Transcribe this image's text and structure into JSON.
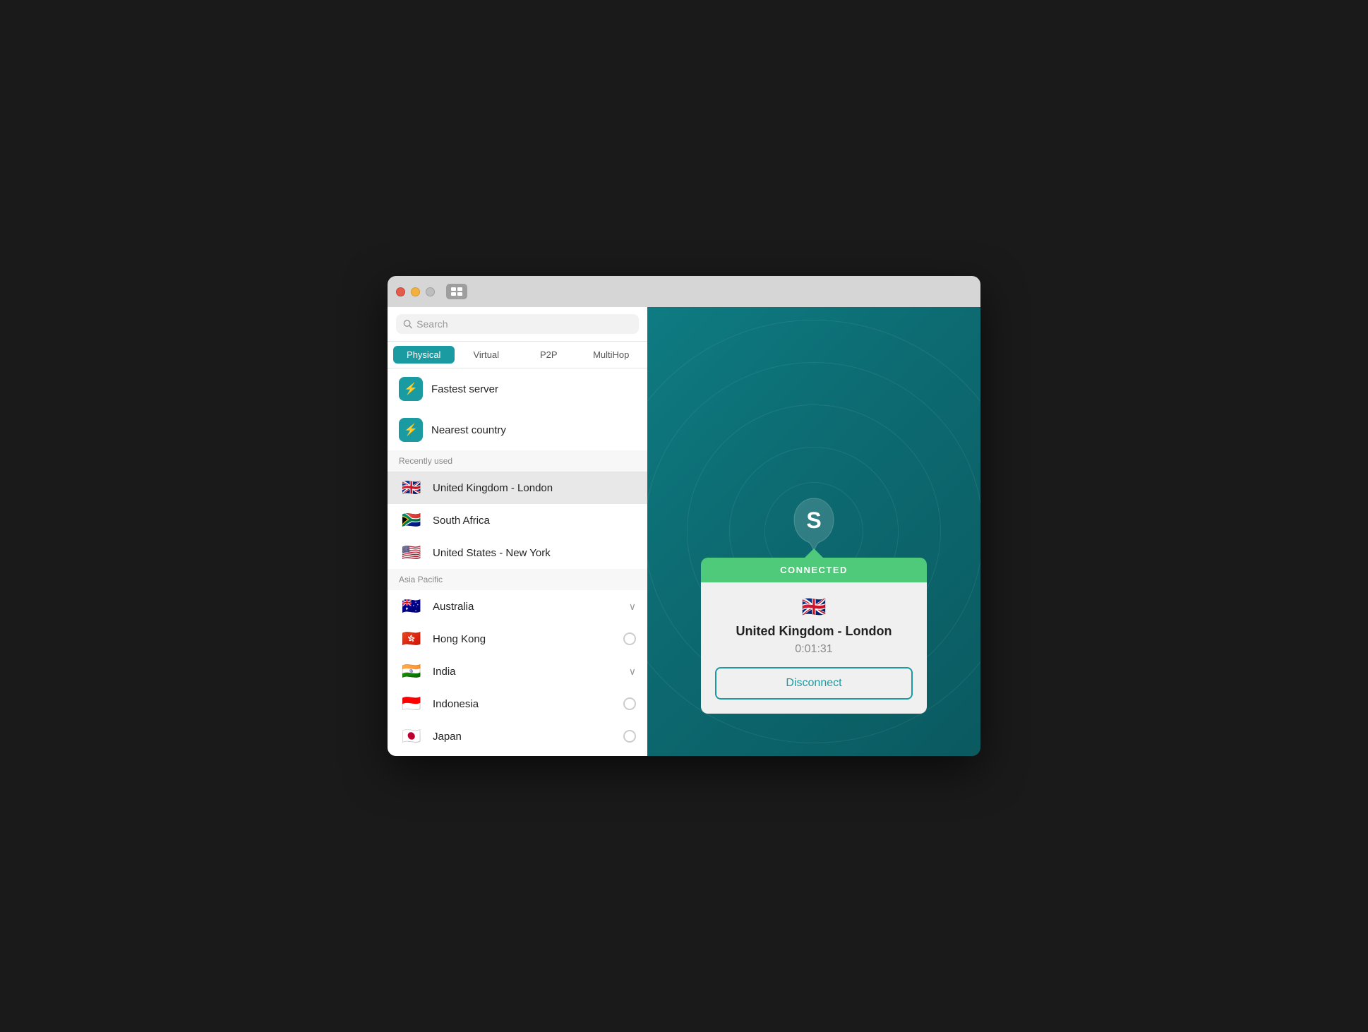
{
  "window": {
    "titlebar": {
      "traffic_lights": [
        "close",
        "minimize",
        "maximize"
      ]
    }
  },
  "sidebar": {
    "search": {
      "placeholder": "Search"
    },
    "tabs": [
      {
        "id": "physical",
        "label": "Physical",
        "active": true
      },
      {
        "id": "virtual",
        "label": "Virtual",
        "active": false
      },
      {
        "id": "p2p",
        "label": "P2P",
        "active": false
      },
      {
        "id": "multihop",
        "label": "MultiHop",
        "active": false
      }
    ],
    "quick_items": [
      {
        "id": "fastest",
        "icon": "⚡",
        "label": "Fastest server"
      },
      {
        "id": "nearest",
        "icon": "⚡",
        "label": "Nearest country"
      }
    ],
    "recently_used_label": "Recently used",
    "recently_used": [
      {
        "id": "uk-london",
        "flag": "🇬🇧",
        "label": "United Kingdom - London",
        "selected": true
      },
      {
        "id": "south-africa",
        "flag": "🇿🇦",
        "label": "South Africa",
        "selected": false
      },
      {
        "id": "us-new-york",
        "flag": "🇺🇸",
        "label": "United States - New York",
        "selected": false
      }
    ],
    "asia_pacific_label": "Asia Pacific",
    "asia_pacific": [
      {
        "id": "australia",
        "flag": "🇦🇺",
        "label": "Australia",
        "expandable": true
      },
      {
        "id": "hong-kong",
        "flag": "🇭🇰",
        "label": "Hong Kong",
        "expandable": false
      },
      {
        "id": "india",
        "flag": "🇮🇳",
        "label": "India",
        "expandable": true
      },
      {
        "id": "indonesia",
        "flag": "🇮🇩",
        "label": "Indonesia",
        "expandable": false
      },
      {
        "id": "japan",
        "flag": "🇯🇵",
        "label": "Japan",
        "expandable": false
      }
    ]
  },
  "main": {
    "connected_label": "CONNECTED",
    "connected_flag": "🇬🇧",
    "connected_location": "United Kingdom - London",
    "connected_timer": "0:01:31",
    "disconnect_label": "Disconnect"
  }
}
